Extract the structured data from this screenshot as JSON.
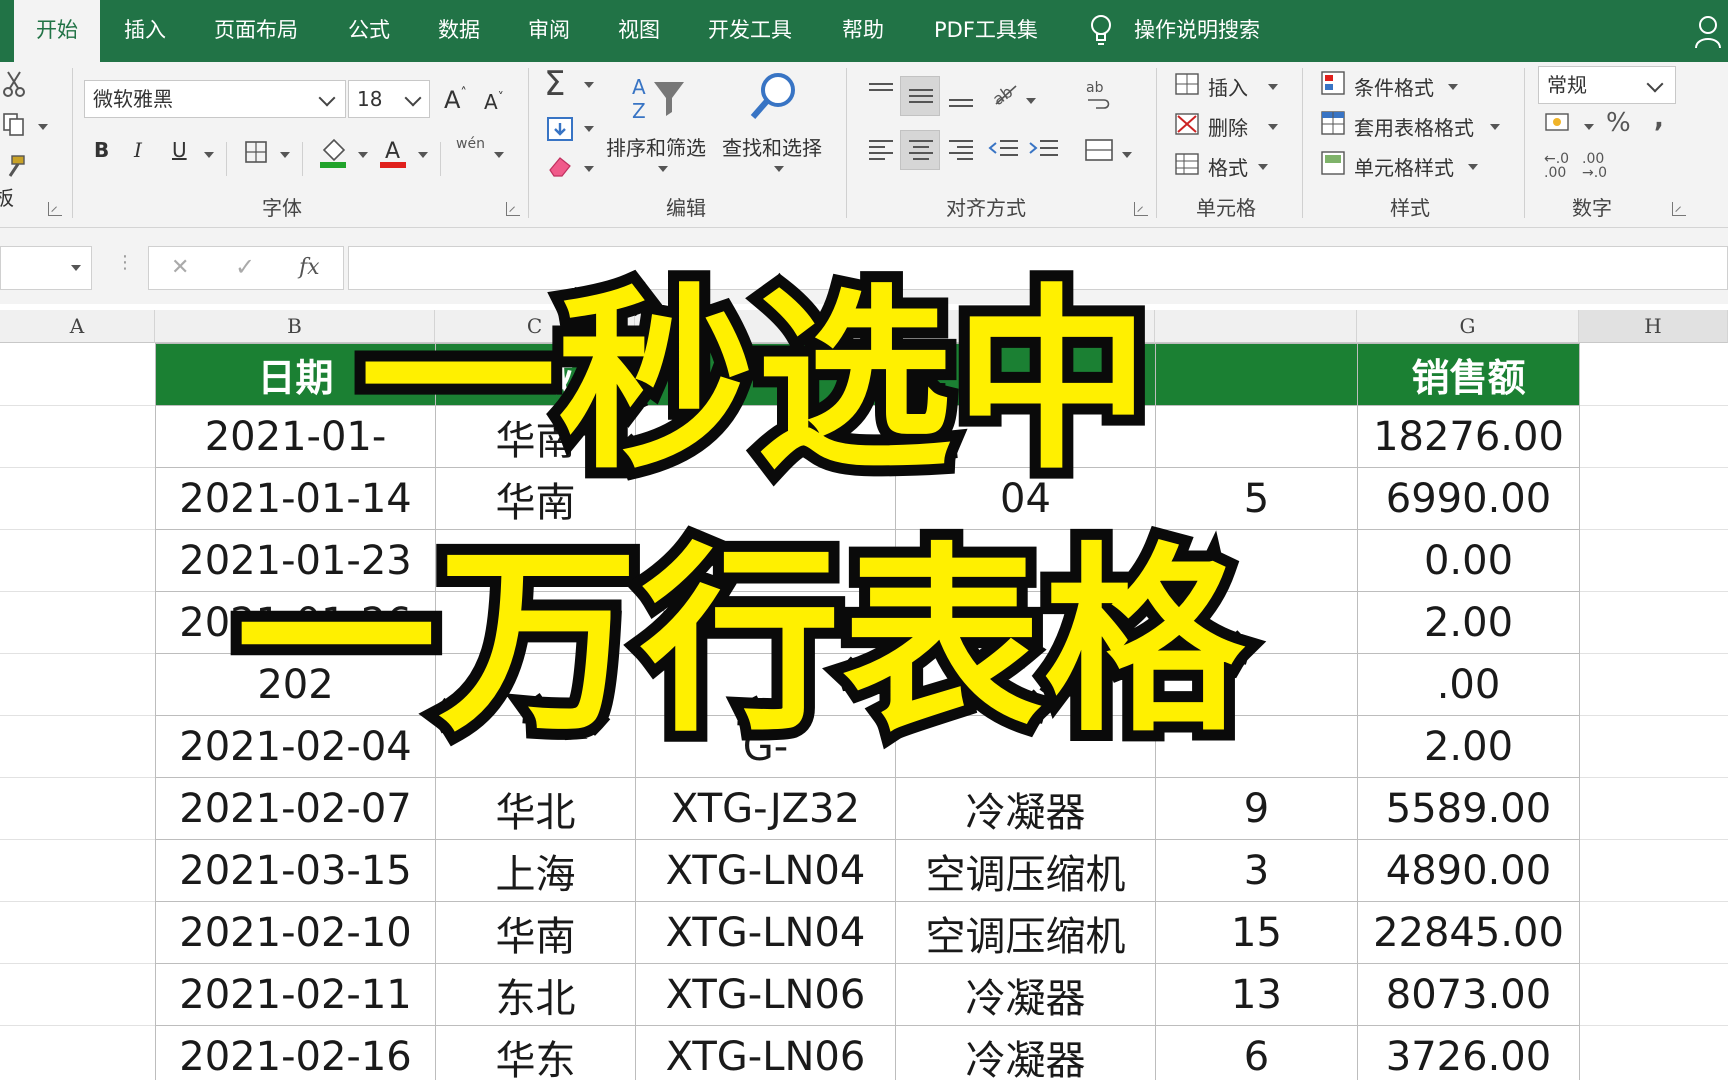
{
  "menu": {
    "tabs": [
      {
        "label": "开始",
        "active": true
      },
      {
        "label": "插入"
      },
      {
        "label": "页面布局"
      },
      {
        "label": "公式"
      },
      {
        "label": "数据"
      },
      {
        "label": "审阅"
      },
      {
        "label": "视图"
      },
      {
        "label": "开发工具"
      },
      {
        "label": "帮助"
      },
      {
        "label": "PDF工具集"
      }
    ],
    "tell_me": "操作说明搜索"
  },
  "ribbon": {
    "font": {
      "name": "微软雅黑",
      "size": "18",
      "bold": "B",
      "italic": "I",
      "underline": "U",
      "phonetic": "wén",
      "group_label": "字体"
    },
    "editing": {
      "sort_filter": "排序和筛选",
      "find_select": "查找和选择",
      "group_label": "编辑"
    },
    "alignment": {
      "group_label": "对齐方式"
    },
    "cells": {
      "insert": "插入",
      "delete": "删除",
      "format": "格式",
      "group_label": "单元格"
    },
    "styles": {
      "conditional": "条件格式",
      "table_format": "套用表格格式",
      "cell_styles": "单元格样式",
      "group_label": "样式"
    },
    "number": {
      "format": "常规",
      "percent": "%",
      "comma": ",",
      "group_label": "数字"
    },
    "clipboard": {
      "group_label_partial": "板"
    }
  },
  "formula_bar": {
    "fx": "fx",
    "cancel": "✕",
    "confirm": "✓"
  },
  "sheet": {
    "columns": [
      "A",
      "B",
      "C",
      "G",
      "H"
    ],
    "headers": [
      "日期",
      "区域",
      "",
      "",
      "",
      "销售额"
    ],
    "rows": [
      [
        "2021-01-",
        "华南",
        "",
        "",
        "",
        "18276.00"
      ],
      [
        "2021-01-14",
        "华南",
        "",
        "04",
        "5",
        "6990.00"
      ],
      [
        "2021-01-23",
        "",
        "",
        "",
        "",
        "0.00"
      ],
      [
        "2021-01-26",
        "",
        "",
        "",
        "",
        "2.00"
      ],
      [
        "202",
        "",
        "",
        "",
        "",
        ".00"
      ],
      [
        "2021-02-04",
        "",
        "G-",
        "",
        "",
        "2.00"
      ],
      [
        "2021-02-07",
        "华北",
        "XTG-JZ32",
        "冷凝器",
        "9",
        "5589.00"
      ],
      [
        "2021-03-15",
        "上海",
        "XTG-LN04",
        "空调压缩机",
        "3",
        "4890.00"
      ],
      [
        "2021-02-10",
        "华南",
        "XTG-LN04",
        "空调压缩机",
        "15",
        "22845.00"
      ],
      [
        "2021-02-11",
        "东北",
        "XTG-LN06",
        "冷凝器",
        "13",
        "8073.00"
      ],
      [
        "2021-02-16",
        "华东",
        "XTG-LN06",
        "冷凝器",
        "6",
        "3726.00"
      ]
    ]
  },
  "overlay": {
    "line1": "一秒选中",
    "line2": "一万行表格"
  },
  "colors": {
    "brand_green": "#217346",
    "header_green": "#1b8033",
    "overlay_yellow": "#fff000"
  }
}
